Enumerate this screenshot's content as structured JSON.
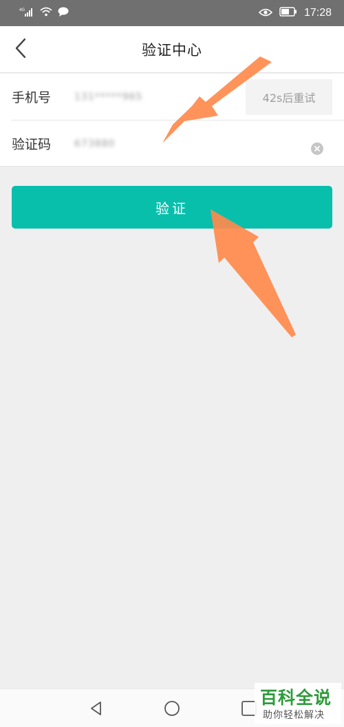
{
  "status_bar": {
    "network": "4G",
    "time": "17:28",
    "icons": [
      "signal-icon",
      "wifi-icon",
      "message-icon",
      "eye-icon",
      "battery-icon"
    ]
  },
  "header": {
    "title": "验证中心",
    "back_icon": "chevron-left-icon"
  },
  "form": {
    "phone": {
      "label": "手机号",
      "value": "131*****965",
      "resend_label": "42s后重试"
    },
    "code": {
      "label": "验证码",
      "value": "673880",
      "clear_icon": "clear-circle-icon"
    }
  },
  "verify_button": {
    "label": "验证",
    "color": "#08bfac"
  },
  "annotations": {
    "arrow_color": "#ff8a4c",
    "arrows": [
      "arrow-to-code-field",
      "arrow-to-verify-button"
    ]
  },
  "watermark": {
    "title": "百科全说",
    "subtitle": "助你轻松解决"
  },
  "nav_bar": {
    "icons": [
      "back-triangle-icon",
      "home-circle-icon",
      "recent-square-icon"
    ]
  }
}
